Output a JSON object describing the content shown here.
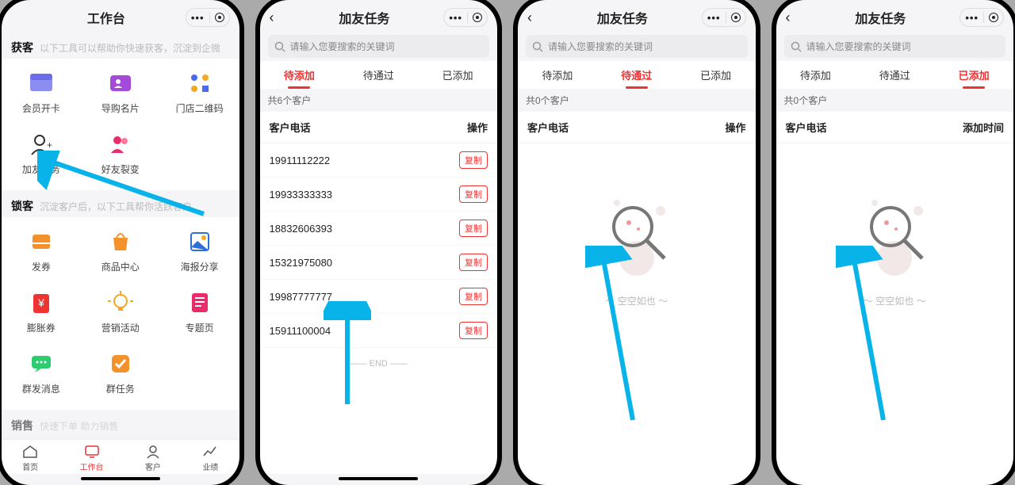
{
  "screen1": {
    "title": "工作台",
    "sections": {
      "huoke": {
        "label": "获客",
        "sub": "以下工具可以帮助你快速获客，沉淀到企微"
      },
      "suoke": {
        "label": "锁客",
        "sub": "沉淀客户后，以下工具帮你活跃客户"
      },
      "xiaoshou": {
        "label": "销售",
        "sub": "快速下单 助力销售"
      }
    },
    "tools_huoke": [
      {
        "label": "会员开卡",
        "name": "member-card"
      },
      {
        "label": "导购名片",
        "name": "guide-card"
      },
      {
        "label": "门店二维码",
        "name": "store-qr"
      },
      {
        "label": "加友任务",
        "name": "add-friend-task"
      },
      {
        "label": "好友裂变",
        "name": "friend-fission"
      }
    ],
    "tools_suoke": [
      {
        "label": "发券",
        "name": "send-coupon"
      },
      {
        "label": "商品中心",
        "name": "product-center"
      },
      {
        "label": "海报分享",
        "name": "poster-share"
      },
      {
        "label": "膨胀券",
        "name": "inflate-coupon"
      },
      {
        "label": "营销活动",
        "name": "marketing-activity"
      },
      {
        "label": "专题页",
        "name": "special-page"
      },
      {
        "label": "群发消息",
        "name": "group-message"
      },
      {
        "label": "群任务",
        "name": "group-task"
      }
    ],
    "nav": [
      {
        "label": "首页",
        "name": "nav-home"
      },
      {
        "label": "工作台",
        "name": "nav-workbench"
      },
      {
        "label": "客户",
        "name": "nav-customer"
      },
      {
        "label": "业绩",
        "name": "nav-performance"
      }
    ]
  },
  "task": {
    "title": "加友任务",
    "search_placeholder": "请输入您要搜索的关键词",
    "tabs": [
      {
        "label": "待添加",
        "key": "pending"
      },
      {
        "label": "待通过",
        "key": "waiting"
      },
      {
        "label": "已添加",
        "key": "added"
      }
    ],
    "count_prefix": "共",
    "count_suffix": "个客户",
    "col_phone": "客户电话",
    "col_action": "操作",
    "col_addtime": "添加时间",
    "copy": "复制",
    "end": "—— END ——",
    "empty": "～ 空空如也 ～"
  },
  "screen2": {
    "count": 6,
    "rows": [
      "19911112222",
      "19933333333",
      "18832606393",
      "15321975080",
      "19987777777",
      "15911100004"
    ]
  },
  "screen3": {
    "count": 0
  },
  "screen4": {
    "count": 0
  }
}
